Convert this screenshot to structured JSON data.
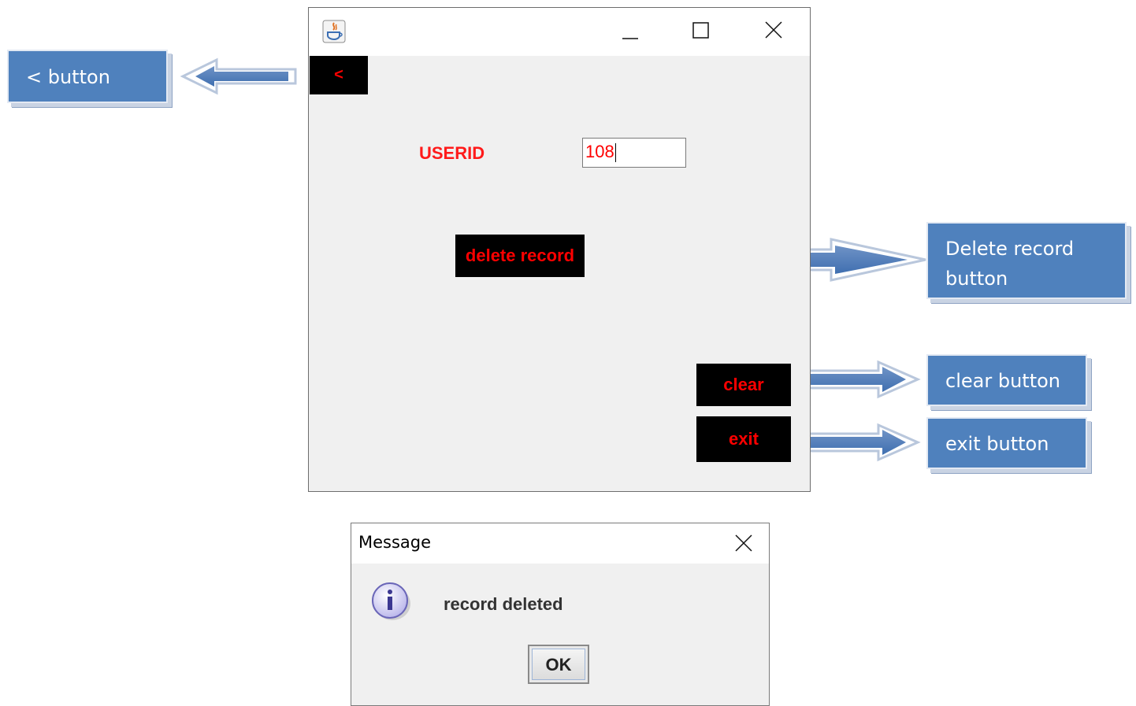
{
  "callouts": {
    "back": "< button",
    "delete_line1": "Delete record",
    "delete_line2": "button",
    "clear": "clear button",
    "exit": "exit button"
  },
  "main_window": {
    "back_label": "<",
    "userid_label": "USERID",
    "userid_value": "108",
    "delete_label": "delete record",
    "clear_label": "clear",
    "exit_label": "exit"
  },
  "dialog": {
    "title": "Message",
    "message": "record deleted",
    "ok_label": "OK"
  },
  "colors": {
    "callout": "#4f81bd",
    "button_bg": "#000000",
    "button_text": "#ff0000"
  }
}
